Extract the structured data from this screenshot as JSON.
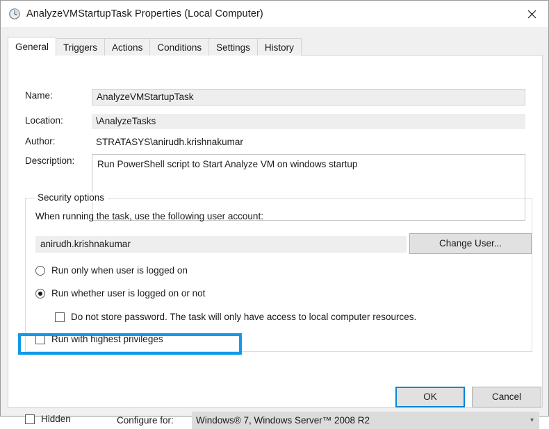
{
  "window": {
    "title": "AnalyzeVMStartupTask Properties (Local Computer)",
    "title_icon": "clock-icon",
    "close_icon": "close-icon",
    "accent_color": "#129ae8",
    "focus_border_color": "#0a84d8"
  },
  "tabs": [
    {
      "label": "General",
      "active": true
    },
    {
      "label": "Triggers",
      "active": false
    },
    {
      "label": "Actions",
      "active": false
    },
    {
      "label": "Conditions",
      "active": false
    },
    {
      "label": "Settings",
      "active": false
    },
    {
      "label": "History",
      "active": false
    }
  ],
  "general": {
    "name": {
      "label": "Name:",
      "value": "AnalyzeVMStartupTask"
    },
    "location": {
      "label": "Location:",
      "value": "\\AnalyzeTasks"
    },
    "author": {
      "label": "Author:",
      "value": "STRATASYS\\anirudh.krishnakumar"
    },
    "description": {
      "label": "Description:",
      "value": "Run PowerShell script to Start Analyze VM on windows startup"
    }
  },
  "security_options": {
    "legend": "Security options",
    "prompt": "When running the task, use the following user account:",
    "account": "anirudh.krishnakumar",
    "change_user_label": "Change User...",
    "radio_logged_on": {
      "label": "Run only when user is logged on",
      "checked": false
    },
    "radio_whether_logged_on": {
      "label": "Run whether user is logged on or not",
      "checked": true,
      "highlighted": true
    },
    "checkbox_no_password": {
      "label": "Do not store password.  The task will only have access to local computer resources.",
      "checked": false
    },
    "checkbox_highest_privileges": {
      "label": "Run with highest privileges",
      "checked": false
    }
  },
  "bottom": {
    "hidden_checkbox": {
      "label": "Hidden",
      "checked": false
    },
    "configure_label": "Configure for:",
    "configure_value": "Windows® 7, Windows Server™ 2008 R2",
    "chevron_icon": "chevron-down-icon"
  },
  "buttons": {
    "ok": "OK",
    "cancel": "Cancel"
  }
}
